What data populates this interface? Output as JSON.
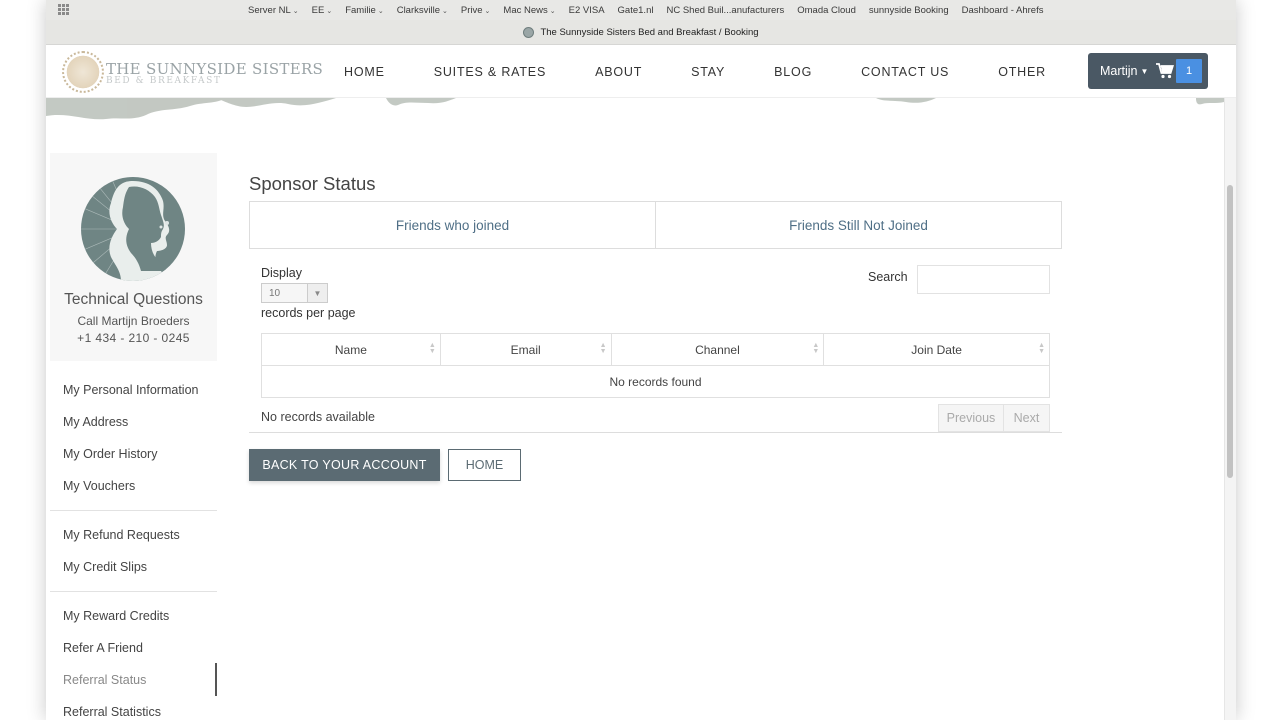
{
  "browser": {
    "bookmarks": [
      {
        "label": "Server NL",
        "folder": true
      },
      {
        "label": "EE",
        "folder": true
      },
      {
        "label": "Familie",
        "folder": true
      },
      {
        "label": "Clarksville",
        "folder": true
      },
      {
        "label": "Prive",
        "folder": true
      },
      {
        "label": "Mac News",
        "folder": true
      },
      {
        "label": "E2 VISA",
        "folder": false
      },
      {
        "label": "Gate1.nl",
        "folder": false
      },
      {
        "label": "NC Shed Buil...anufacturers",
        "folder": false
      },
      {
        "label": "Omada Cloud",
        "folder": false
      },
      {
        "label": "sunnyside Booking",
        "folder": false
      },
      {
        "label": "Dashboard - Ahrefs",
        "folder": false
      }
    ],
    "tab_title": "The Sunnyside Sisters Bed and Breakfast / Booking"
  },
  "header": {
    "logo_title": "THE SUNNYSIDE SISTERS",
    "logo_subtitle": "BED & BREAKFAST",
    "nav": [
      "HOME",
      "SUITES & RATES",
      "ABOUT",
      "STAY",
      "BLOG",
      "CONTACT US",
      "OTHER"
    ],
    "account_name": "Martijn",
    "cart_count": "1"
  },
  "sidebar": {
    "title": "Technical Questions",
    "call_text": "Call Martijn Broeders",
    "phone": "+1 434 - 210 - 0245",
    "links": [
      "My Personal Information",
      "My Address",
      "My Order History",
      "My Vouchers",
      "My Refund Requests",
      "My Credit Slips",
      "My Reward Credits",
      "Refer A Friend",
      "Referral Status",
      "Referral Statistics"
    ],
    "active_link": "Referral Status"
  },
  "main": {
    "title": "Sponsor Status",
    "tabs": [
      "Friends who joined",
      "Friends Still Not Joined"
    ],
    "display_label": "Display",
    "length_value": "10",
    "per_page_label": "records per page",
    "search_label": "Search",
    "search_value": "",
    "columns": [
      "Name",
      "Email",
      "Channel",
      "Join Date"
    ],
    "empty_message": "No records found",
    "info_text": "No records available",
    "prev_label": "Previous",
    "next_label": "Next",
    "back_button": "BACK TO YOUR ACCOUNT",
    "home_button": "HOME"
  },
  "colors": {
    "accent_dark": "#4a5864",
    "button_primary": "#5b6b73",
    "tab_link": "#4f6f86",
    "cart_badge": "#4a90e2"
  }
}
